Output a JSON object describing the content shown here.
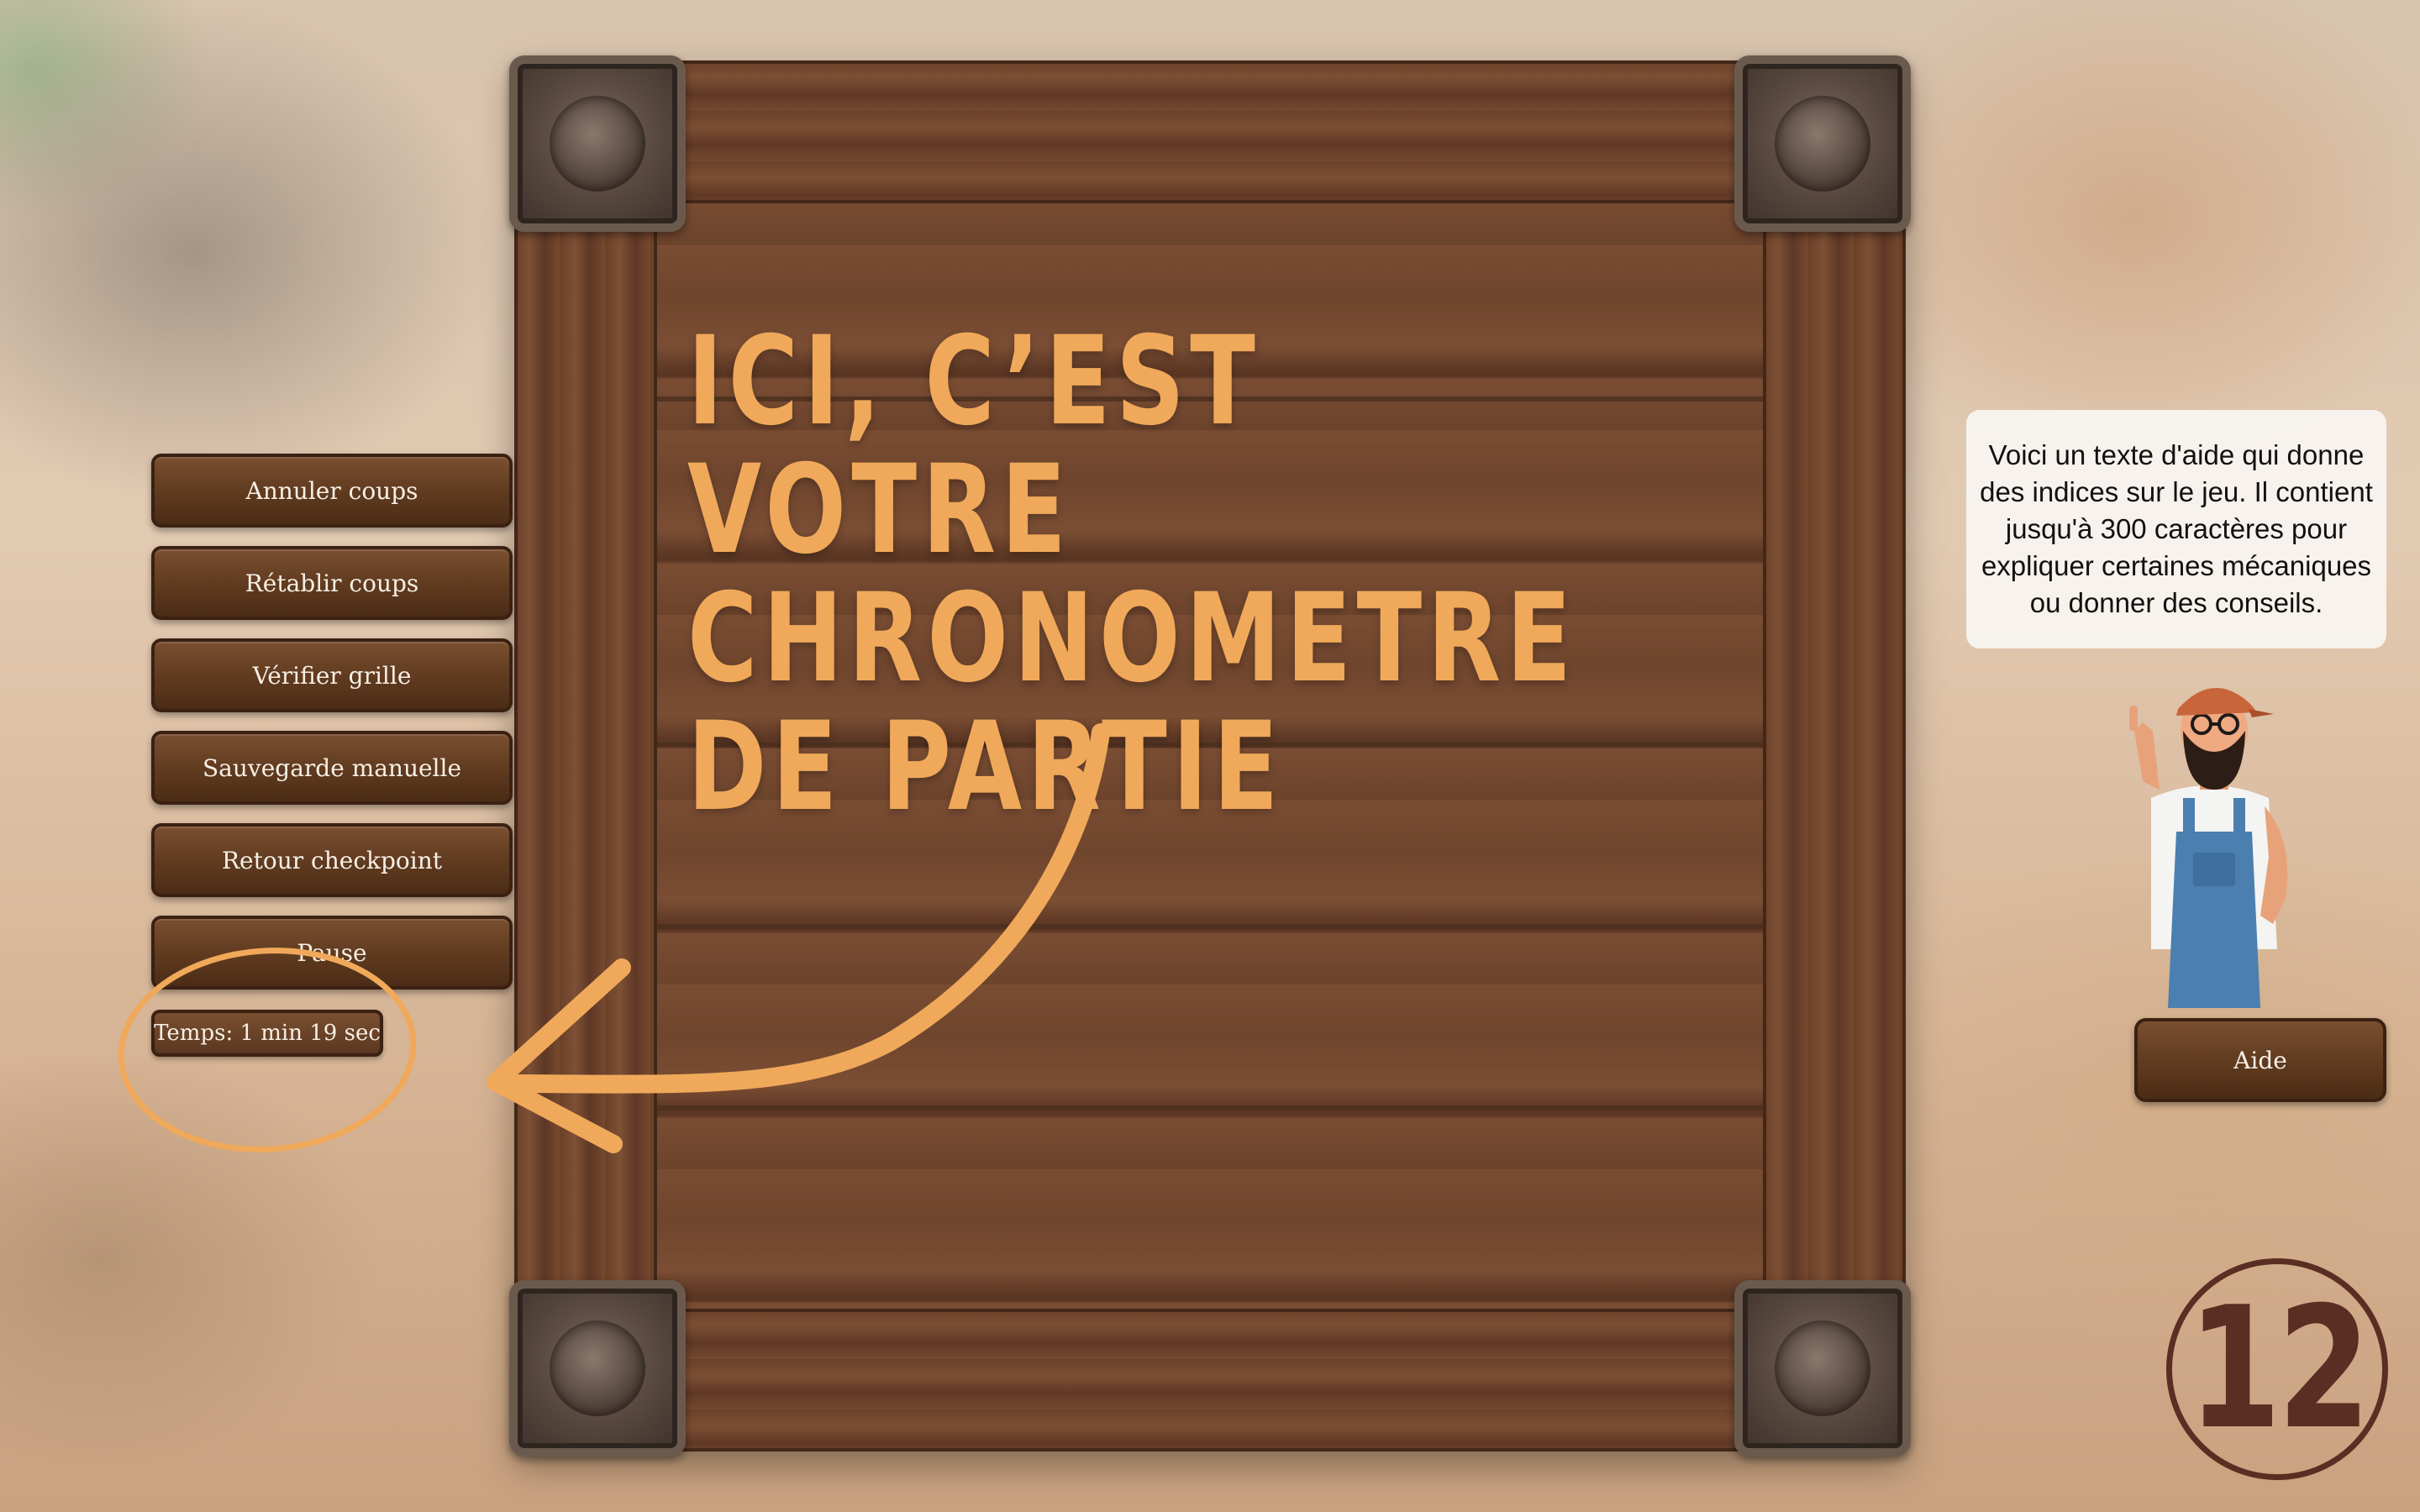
{
  "controls": {
    "buttons": [
      {
        "label": "Annuler coups"
      },
      {
        "label": "Rétablir coups"
      },
      {
        "label": "Vérifier grille"
      },
      {
        "label": "Sauvegarde manuelle"
      },
      {
        "label": "Retour checkpoint"
      },
      {
        "label": "Pause"
      }
    ],
    "timer": "Temps: 1 min 19 sec"
  },
  "overlay": {
    "title": "ICI, C’EST VOTRE CHRONOMETRE DE PARTIE",
    "accent_color": "#f0a95a"
  },
  "help": {
    "text": "Voici un texte d'aide qui donne des indices sur le jeu. Il contient jusqu'à 300 caractères pour expliquer certaines mécaniques ou donner des conseils.",
    "button_label": "Aide"
  },
  "step": {
    "number": "12",
    "color": "#5a2e22"
  },
  "icons": {
    "corners": "stone-ornament-icon",
    "character": "helper-character-icon",
    "arrow": "annotation-arrow-icon",
    "circle": "annotation-circle-icon"
  }
}
